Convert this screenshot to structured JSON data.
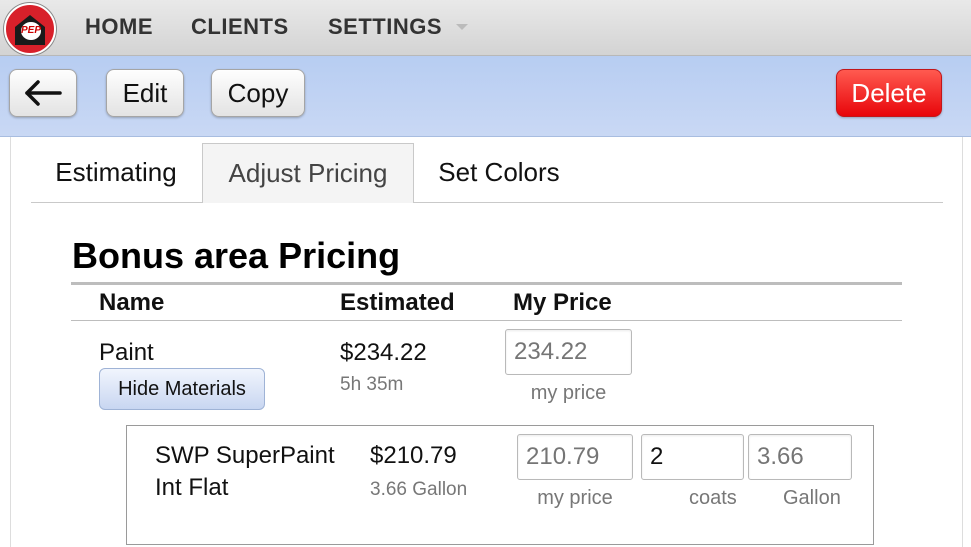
{
  "nav": {
    "logo_text": "PEP",
    "items": [
      {
        "label": "HOME"
      },
      {
        "label": "CLIENTS"
      },
      {
        "label": "SETTINGS"
      }
    ]
  },
  "toolbar": {
    "back_icon": "left-arrow-icon",
    "edit_label": "Edit",
    "copy_label": "Copy",
    "delete_label": "Delete",
    "delete_color": "#e8050a"
  },
  "tabs": [
    {
      "label": "Estimating",
      "active": false
    },
    {
      "label": "Adjust Pricing",
      "active": true
    },
    {
      "label": "Set Colors",
      "active": false
    }
  ],
  "section": {
    "title": "Bonus area Pricing",
    "columns": [
      "Name",
      "Estimated",
      "My Price"
    ]
  },
  "row": {
    "name": "Paint",
    "estimated": "$234.22",
    "time": "5h 35m",
    "my_price_placeholder": "234.22",
    "my_price_label": "my price",
    "hide_materials_label": "Hide Materials"
  },
  "material": {
    "name_line1": "SWP SuperPaint",
    "name_line2": "Int Flat",
    "estimated": "$210.79",
    "quantity": "3.66 Gallon",
    "price_placeholder": "210.79",
    "price_label": "my price",
    "coats_value": "2",
    "coats_label": "coats",
    "gallon_placeholder": "3.66",
    "gallon_label": "Gallon"
  }
}
